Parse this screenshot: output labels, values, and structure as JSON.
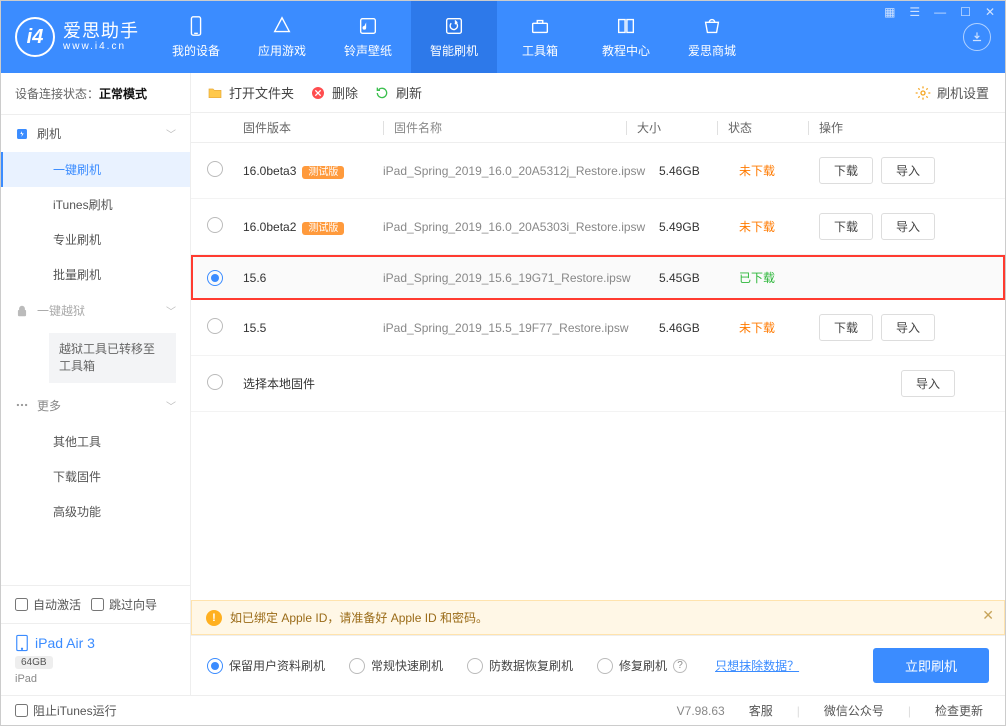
{
  "app": {
    "name": "爱思助手",
    "url": "www.i4.cn"
  },
  "nav": {
    "items": [
      {
        "label": "我的设备"
      },
      {
        "label": "应用游戏"
      },
      {
        "label": "铃声壁纸"
      },
      {
        "label": "智能刷机"
      },
      {
        "label": "工具箱"
      },
      {
        "label": "教程中心"
      },
      {
        "label": "爱思商城"
      }
    ]
  },
  "sidebar": {
    "device_state_label": "设备连接状态：",
    "device_state_value": "正常模式",
    "groups": {
      "flash": {
        "title": "刷机",
        "items": [
          "一键刷机",
          "iTunes刷机",
          "专业刷机",
          "批量刷机"
        ]
      },
      "jailbreak": {
        "title": "一键越狱",
        "note": "越狱工具已转移至工具箱"
      },
      "more": {
        "title": "更多",
        "items": [
          "其他工具",
          "下载固件",
          "高级功能"
        ]
      }
    },
    "auto_activate": "自动激活",
    "skip_guide": "跳过向导",
    "device": {
      "name": "iPad Air 3",
      "storage": "64GB",
      "type": "iPad"
    }
  },
  "toolbar": {
    "open": "打开文件夹",
    "delete": "删除",
    "refresh": "刷新",
    "settings": "刷机设置"
  },
  "table": {
    "headers": {
      "version": "固件版本",
      "name": "固件名称",
      "size": "大小",
      "status": "状态",
      "action": "操作"
    },
    "rows": [
      {
        "selected": false,
        "version": "16.0beta3",
        "beta": "测试版",
        "name": "iPad_Spring_2019_16.0_20A5312j_Restore.ipsw",
        "size": "5.46GB",
        "status": "未下载",
        "status_class": "orange",
        "can_download": true
      },
      {
        "selected": false,
        "version": "16.0beta2",
        "beta": "测试版",
        "name": "iPad_Spring_2019_16.0_20A5303i_Restore.ipsw",
        "size": "5.49GB",
        "status": "未下载",
        "status_class": "orange",
        "can_download": true
      },
      {
        "selected": true,
        "version": "15.6",
        "beta": "",
        "name": "iPad_Spring_2019_15.6_19G71_Restore.ipsw",
        "size": "5.45GB",
        "status": "已下载",
        "status_class": "green",
        "can_download": false,
        "highlight": true
      },
      {
        "selected": false,
        "version": "15.5",
        "beta": "",
        "name": "iPad_Spring_2019_15.5_19F77_Restore.ipsw",
        "size": "5.46GB",
        "status": "未下载",
        "status_class": "orange",
        "can_download": true
      }
    ],
    "local_label": "选择本地固件",
    "download_btn": "下载",
    "import_btn": "导入"
  },
  "notice": "如已绑定 Apple ID，请准备好 Apple ID 和密码。",
  "flash_options": {
    "keep_data": "保留用户资料刷机",
    "normal": "常规快速刷机",
    "anti_recovery": "防数据恢复刷机",
    "repair": "修复刷机",
    "erase_link": "只想抹除数据？",
    "go": "立即刷机"
  },
  "footer": {
    "block_itunes": "阻止iTunes运行",
    "version": "V7.98.63",
    "service": "客服",
    "wechat": "微信公众号",
    "update": "检查更新"
  }
}
